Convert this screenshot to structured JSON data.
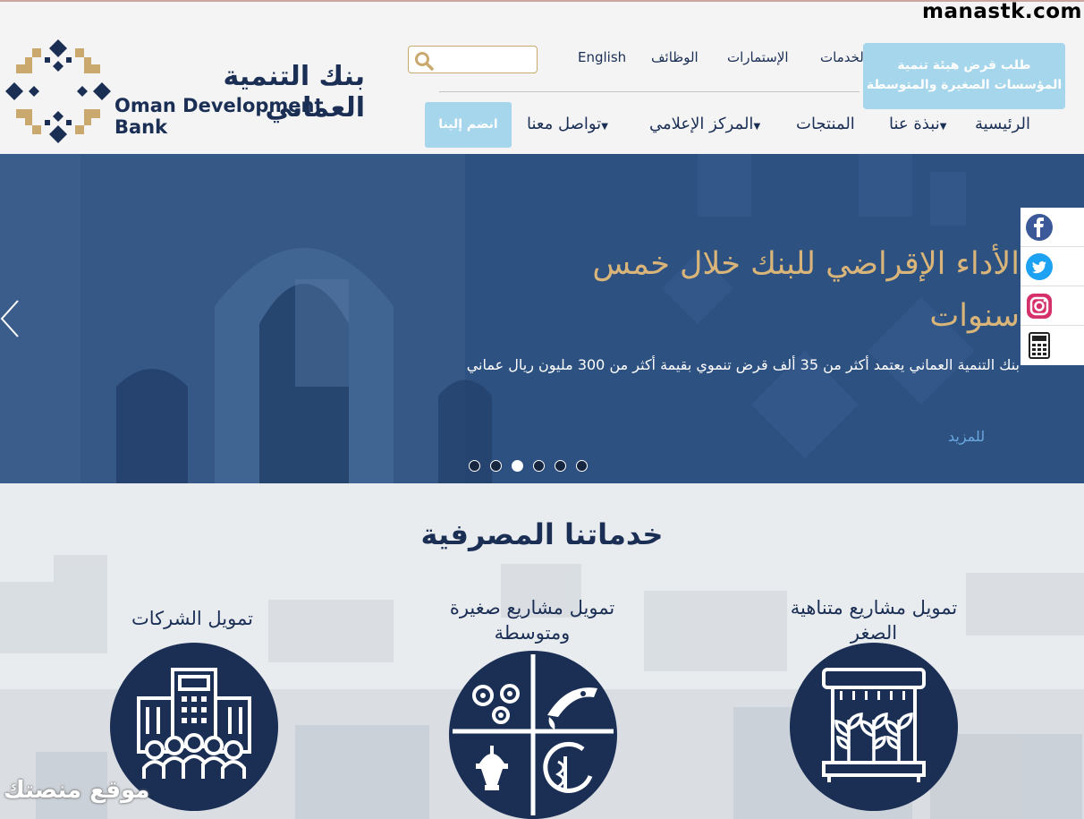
{
  "watermark": "manastk.com",
  "logo": {
    "arabic_name": "بنك التنمية العماني",
    "english_name": "Oman Development Bank"
  },
  "search": {
    "placeholder": "",
    "icon": "search-icon"
  },
  "top_links": {
    "english": "English",
    "jobs": "الوظائف",
    "forms": "الإستمارات",
    "services": "لخدمات"
  },
  "loan_button": {
    "line1": "طلب قرض هيئة تنمية",
    "line2": "المؤسسات الصغيرة والمتوسطة"
  },
  "nav": {
    "home": "الرئيسية",
    "about": "نبذة عنا",
    "products": "المنتجات",
    "media": "المركز الإعلامي",
    "contact": "تواصل معنا",
    "join": "انضم إلينا"
  },
  "hero": {
    "title": "الأداء الإقراضي للبنك خلال خمس سنوات",
    "text": "بنك التنمية العماني يعتمد  أكثر  من 35 ألف قرض تنموي بقيمة أكثر  من 300 مليون  ريال عماني",
    "more": "للمزيد",
    "slide_count": 6,
    "active_slide": 3
  },
  "social": [
    "facebook-icon",
    "twitter-icon",
    "instagram-icon",
    "calculator-icon"
  ],
  "services": {
    "title": "خدماتنا المصرفية",
    "items": [
      {
        "title": "تمويل الشركات",
        "icon": "corporate-building-icon"
      },
      {
        "title": "تمويل مشاريع صغيرة ومتوسطة",
        "icon": "sme-sectors-icon"
      },
      {
        "title": "تمويل مشاريع متناهية الصغر",
        "icon": "micro-plants-icon"
      }
    ]
  },
  "footer_watermark": "موقع منصتك",
  "colors": {
    "navy": "#1b2f55",
    "gold": "#c9a96e",
    "light_blue": "#a6d6ec",
    "hero_bg": "#2b4f7d"
  }
}
